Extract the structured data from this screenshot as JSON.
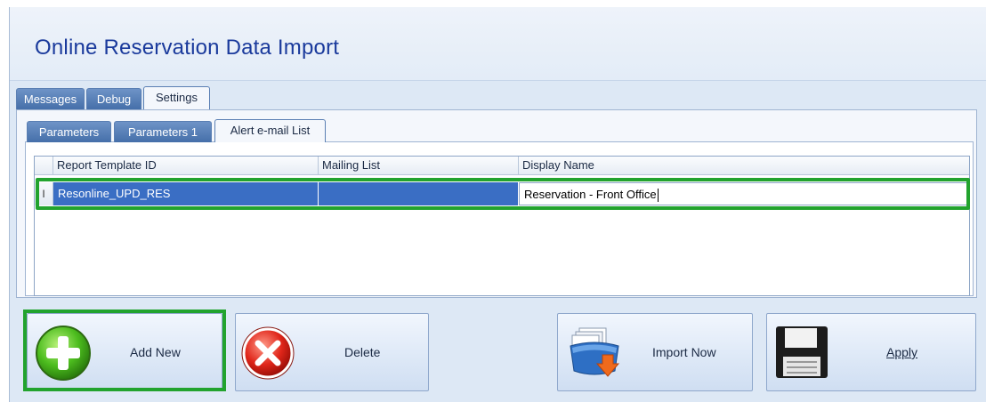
{
  "window": {
    "title": "Online Reservation Data Import"
  },
  "tabs_top": [
    {
      "label": "Messages",
      "active": false
    },
    {
      "label": "Debug",
      "active": false
    },
    {
      "label": "Settings",
      "active": true
    }
  ],
  "tabs_sub": [
    {
      "label": "Parameters",
      "active": false
    },
    {
      "label": "Parameters 1",
      "active": false
    },
    {
      "label": "Alert e-mail List",
      "active": true
    }
  ],
  "grid": {
    "columns": [
      "Report Template ID",
      "Mailing List",
      "Display Name"
    ],
    "rows": [
      {
        "indicator": "I",
        "report_template_id": "Resonline_UPD_RES",
        "mailing_list": "",
        "display_name": "Reservation - Front Office"
      }
    ]
  },
  "buttons": {
    "add_new": "Add New",
    "delete": "Delete",
    "import_now": "Import Now",
    "apply": "Apply"
  },
  "colors": {
    "title": "#1a3a9c",
    "highlight": "#22a32e",
    "selected_row": "#3a6ec4"
  }
}
